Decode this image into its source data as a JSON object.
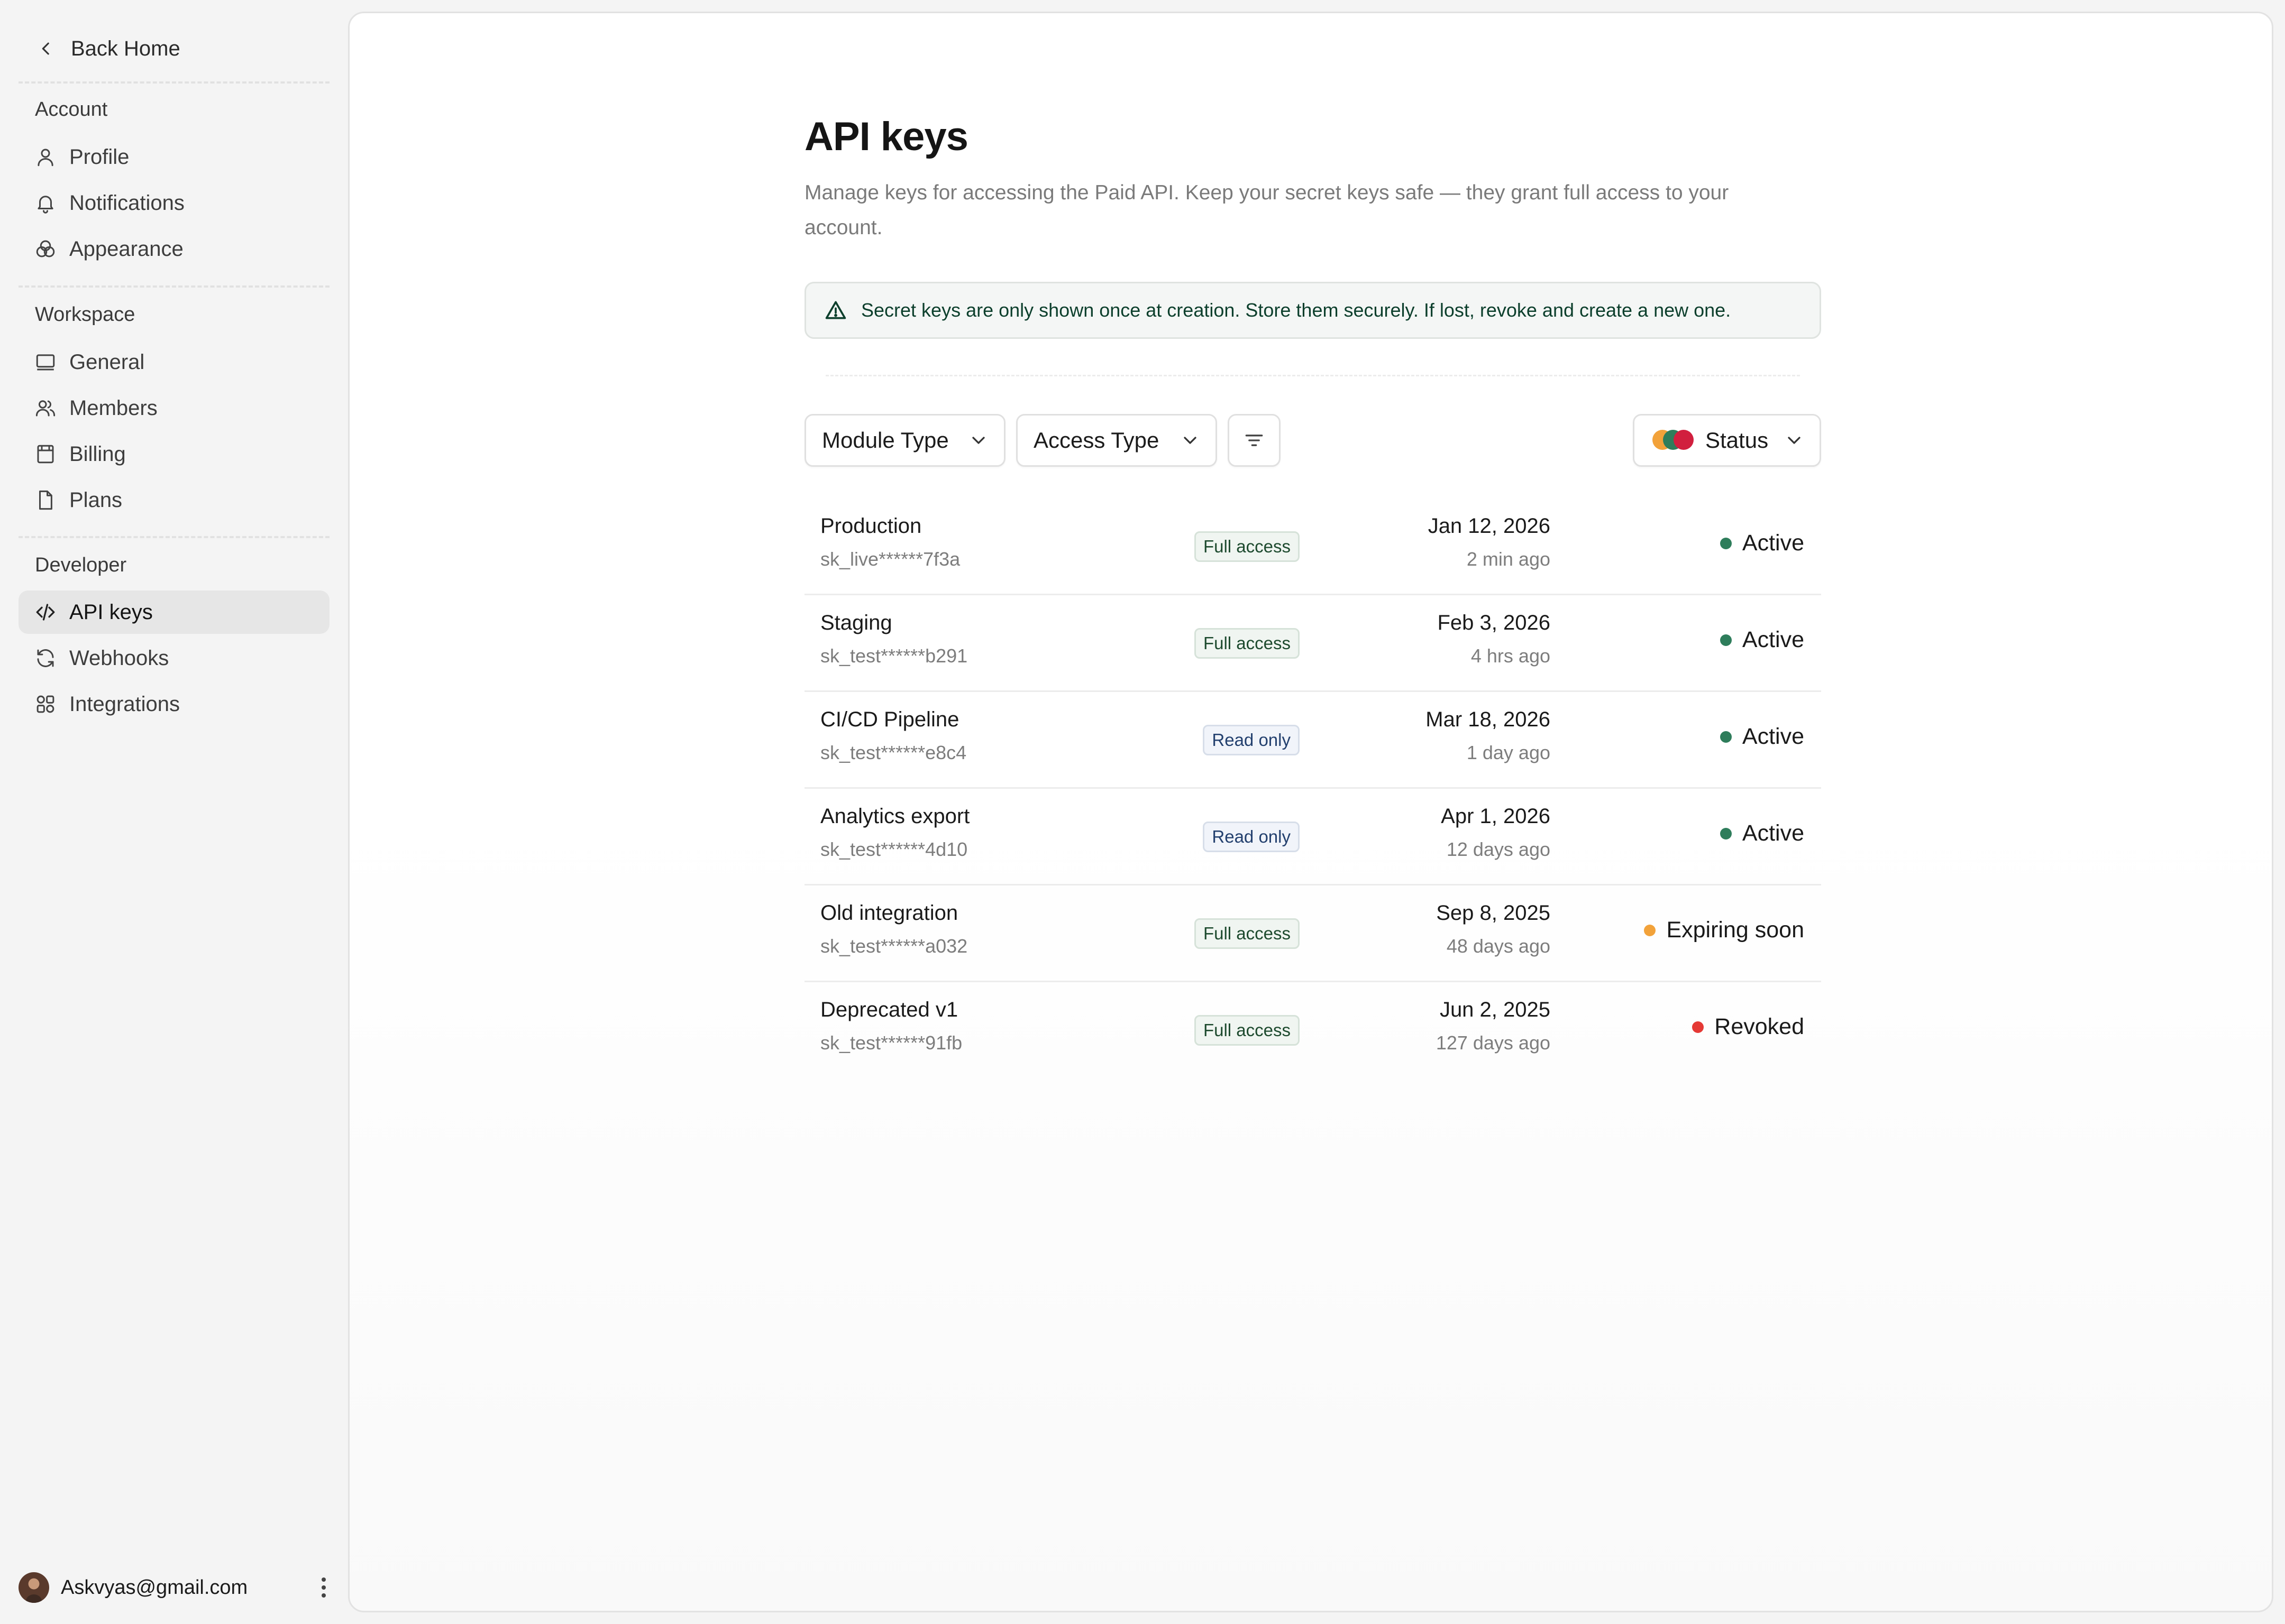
{
  "colors": {
    "active": "#2e7d5b",
    "expiring": "#f2a23a",
    "revoked": "#e53935",
    "alert_text": "#0c3f2c"
  },
  "sidebar": {
    "back_label": "Back Home",
    "sections": [
      {
        "label": "Account",
        "items": [
          {
            "label": "Profile",
            "icon": "user-icon",
            "active": false
          },
          {
            "label": "Notifications",
            "icon": "bell-icon",
            "active": false
          },
          {
            "label": "Appearance",
            "icon": "palette-icon",
            "active": false
          }
        ]
      },
      {
        "label": "Workspace",
        "items": [
          {
            "label": "General",
            "icon": "monitor-icon",
            "active": false
          },
          {
            "label": "Members",
            "icon": "users-icon",
            "active": false
          },
          {
            "label": "Billing",
            "icon": "receipt-icon",
            "active": false
          },
          {
            "label": "Plans",
            "icon": "file-icon",
            "active": false
          }
        ]
      },
      {
        "label": "Developer",
        "items": [
          {
            "label": "API keys",
            "icon": "code-icon",
            "active": true
          },
          {
            "label": "Webhooks",
            "icon": "refresh-icon",
            "active": false
          },
          {
            "label": "Integrations",
            "icon": "grid-icon",
            "active": false
          }
        ]
      }
    ],
    "user_email": "Askvyas@gmail.com"
  },
  "main": {
    "title": "API keys",
    "description": "Manage keys for accessing the Paid API. Keep your secret keys safe — they grant full access to your account.",
    "alert": "Secret keys are only shown once at creation. Store them securely. If lost, revoke and create a new one.",
    "filters": {
      "module_type": "Module Type",
      "access_type": "Access Type",
      "status": "Status"
    },
    "keys": [
      {
        "name": "Production",
        "key": "sk_live******7f3a",
        "access": "Full access",
        "access_kind": "full",
        "date": "Jan 12, 2026",
        "ago": "2 min ago",
        "status": "Active",
        "status_kind": "active"
      },
      {
        "name": "Staging",
        "key": "sk_test******b291",
        "access": "Full access",
        "access_kind": "full",
        "date": "Feb 3, 2026",
        "ago": "4 hrs ago",
        "status": "Active",
        "status_kind": "active"
      },
      {
        "name": "CI/CD Pipeline",
        "key": "sk_test******e8c4",
        "access": "Read only",
        "access_kind": "read",
        "date": "Mar 18, 2026",
        "ago": "1 day ago",
        "status": "Active",
        "status_kind": "active"
      },
      {
        "name": "Analytics export",
        "key": "sk_test******4d10",
        "access": "Read only",
        "access_kind": "read",
        "date": "Apr 1, 2026",
        "ago": "12 days ago",
        "status": "Active",
        "status_kind": "active"
      },
      {
        "name": "Old integration",
        "key": "sk_test******a032",
        "access": "Full access",
        "access_kind": "full",
        "date": "Sep 8, 2025",
        "ago": "48 days ago",
        "status": "Expiring soon",
        "status_kind": "expiring"
      },
      {
        "name": "Deprecated v1",
        "key": "sk_test******91fb",
        "access": "Full access",
        "access_kind": "full",
        "date": "Jun 2, 2025",
        "ago": "127 days ago",
        "status": "Revoked",
        "status_kind": "revoked"
      }
    ]
  }
}
